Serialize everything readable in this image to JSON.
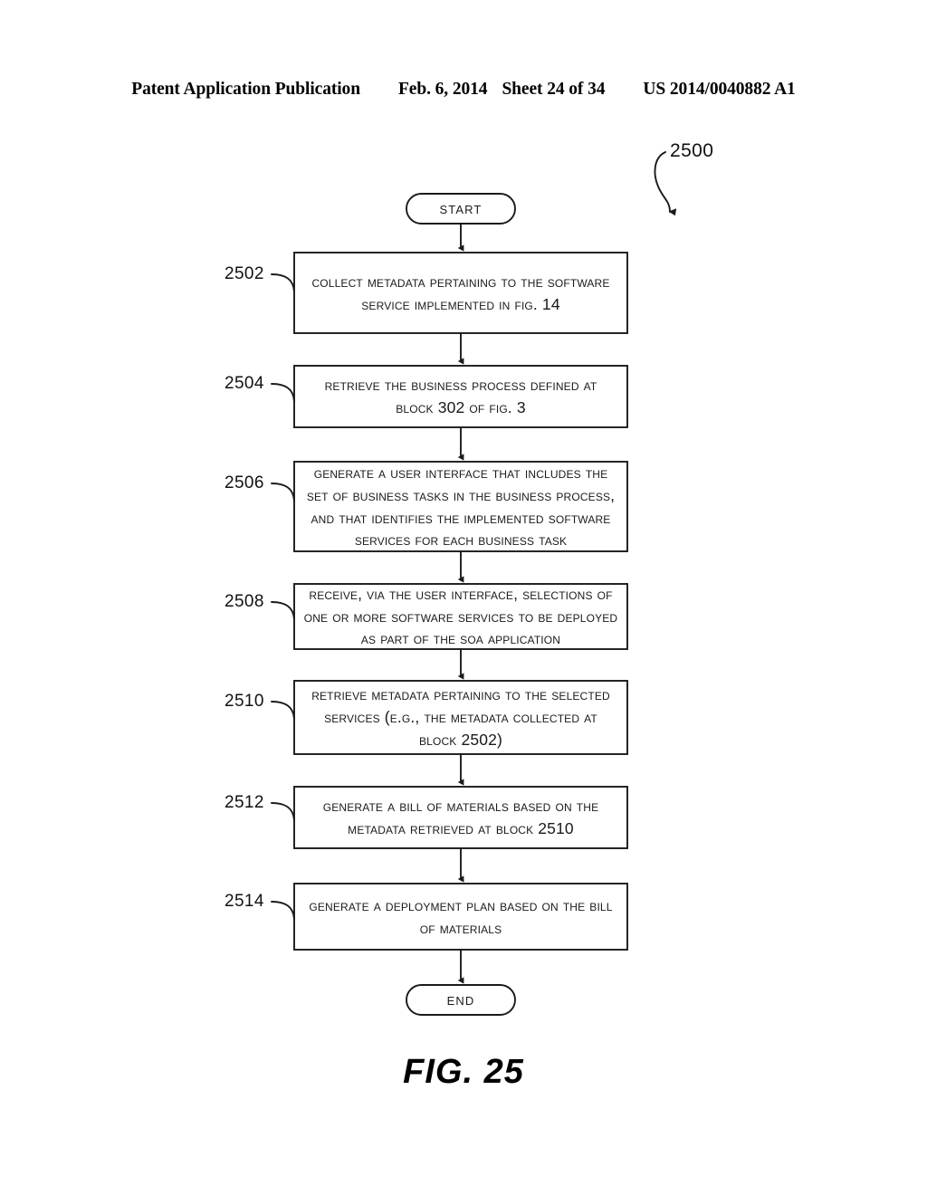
{
  "header": {
    "publication": "Patent Application Publication",
    "date": "Feb. 6, 2014",
    "sheet": "Sheet 24 of 34",
    "patent_number": "US 2014/0040882 A1"
  },
  "figure": {
    "caption": "FIG. 25",
    "figure_ref": "2500"
  },
  "flowchart": {
    "start": {
      "label": "Start"
    },
    "end": {
      "label": "End"
    },
    "steps": [
      {
        "ref": "2502",
        "lines": [
          "Collect metadata pertaining to the software",
          "service implemented in FIG. 14"
        ]
      },
      {
        "ref": "2504",
        "lines": [
          "Retrieve the business process defined at",
          "block 302 of FIG. 3"
        ]
      },
      {
        "ref": "2506",
        "lines": [
          "Generate a user interface that includes the",
          "set of business tasks in the business process,",
          "and that identifies the implemented software",
          "services for each business task"
        ]
      },
      {
        "ref": "2508",
        "lines": [
          "Receive, via the user interface, selections of",
          "one or more software services to be deployed",
          "as part of the SOA application"
        ]
      },
      {
        "ref": "2510",
        "lines": [
          "Retrieve metadata pertaining to the selected",
          "services (e.g., the metadata collected at",
          "block 2502)"
        ]
      },
      {
        "ref": "2512",
        "lines": [
          "Generate a bill of materials based on the",
          "metadata retrieved at block 2510"
        ]
      },
      {
        "ref": "2514",
        "lines": [
          "Generate a deployment plan based on the bill",
          "of materials"
        ]
      }
    ]
  },
  "style": {
    "line_color": "#1a1a1a",
    "text_color": "#1a1a1a",
    "background": "#ffffff"
  }
}
